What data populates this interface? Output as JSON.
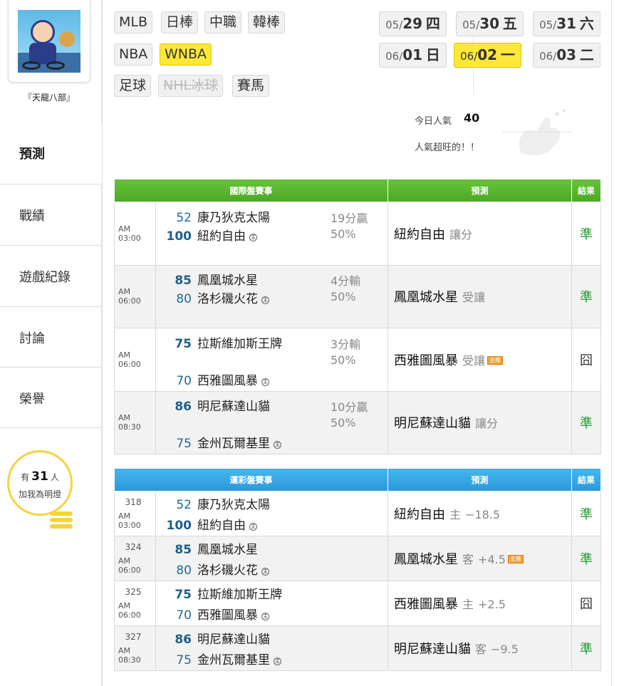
{
  "sidebar": {
    "username": "『天龍八部』",
    "nav": [
      "預測",
      "戰績",
      "遊戲紀錄",
      "討論",
      "榮譽"
    ],
    "fans_prefix": "有",
    "fans_count": "31",
    "fans_suffix": "人",
    "fans_text": "加我為明燈"
  },
  "sports": {
    "row1": [
      "MLB",
      "日棒",
      "中職",
      "韓棒"
    ],
    "row2": [
      "NBA",
      "WNBA"
    ],
    "row3": [
      "足球",
      "NHL冰球",
      "賽馬"
    ],
    "selected": "WNBA",
    "disabled": "NHL冰球"
  },
  "dates": [
    {
      "month": "05/",
      "day": "29",
      "weekday": "四"
    },
    {
      "month": "05/",
      "day": "30",
      "weekday": "五"
    },
    {
      "month": "05/",
      "day": "31",
      "weekday": "六"
    },
    {
      "month": "06/",
      "day": "01",
      "weekday": "日"
    },
    {
      "month": "06/",
      "day": "02",
      "weekday": "一"
    },
    {
      "month": "06/",
      "day": "03",
      "weekday": "二"
    }
  ],
  "selected_date": "06/02",
  "popularity": {
    "label": "今日人氣",
    "value": "40",
    "text": "人氣超旺的！！"
  },
  "intl_table": {
    "headers": [
      "國際盤賽事",
      "預測",
      "結果"
    ],
    "rows": [
      {
        "time": "AM 03:00",
        "away_score": "52",
        "away_team": "康乃狄克太陽",
        "home_score": "100",
        "home_team": "紐約自由",
        "home_mark": "主",
        "line": "19分贏",
        "pct": "50%",
        "pred_team": "紐約自由",
        "pred_sub": "讓分",
        "badge": "",
        "result": "準"
      },
      {
        "time": "AM 06:00",
        "away_score": "85",
        "away_team": "鳳凰城水星",
        "home_score": "80",
        "home_team": "洛杉磯火花",
        "home_mark": "主",
        "line": "4分輸",
        "pct": "50%",
        "pred_team": "鳳凰城水星",
        "pred_sub": "受讓",
        "badge": "",
        "result": "準"
      },
      {
        "time": "AM 06:00",
        "away_score": "75",
        "away_team": "拉斯維加斯王牌",
        "home_score": "70",
        "home_team": "西雅圖風暴",
        "home_mark": "主",
        "line": "3分輸",
        "pct": "50%",
        "pred_team": "西雅圖風暴",
        "pred_sub": "受讓",
        "badge": "主推",
        "result": "囧"
      },
      {
        "time": "AM 08:30",
        "away_score": "86",
        "away_team": "明尼蘇達山貓",
        "home_score": "75",
        "home_team": "金州瓦爾基里",
        "home_mark": "主",
        "line": "10分贏",
        "pct": "50%",
        "pred_team": "明尼蘇達山貓",
        "pred_sub": "讓分",
        "badge": "",
        "result": "準"
      }
    ]
  },
  "lottery_table": {
    "headers": [
      "運彩盤賽事",
      "預測",
      "結果"
    ],
    "rows": [
      {
        "no": "318",
        "time": "AM 03:00",
        "away_score": "52",
        "away_team": "康乃狄克太陽",
        "home_score": "100",
        "home_team": "紐約自由",
        "home_mark": "主",
        "pred_team": "紐約自由",
        "pred_side": "主",
        "pred_line": "−18.5",
        "badge": "",
        "result": "準"
      },
      {
        "no": "324",
        "time": "AM 06:00",
        "away_score": "85",
        "away_team": "鳳凰城水星",
        "home_score": "80",
        "home_team": "洛杉磯火花",
        "home_mark": "主",
        "pred_team": "鳳凰城水星",
        "pred_side": "客",
        "pred_line": "+4.5",
        "badge": "主推",
        "result": "準"
      },
      {
        "no": "325",
        "time": "AM 06:00",
        "away_score": "75",
        "away_team": "拉斯維加斯王牌",
        "home_score": "70",
        "home_team": "西雅圖風暴",
        "home_mark": "主",
        "pred_team": "西雅圖風暴",
        "pred_side": "主",
        "pred_line": "+2.5",
        "badge": "",
        "result": "囧"
      },
      {
        "no": "327",
        "time": "AM 08:30",
        "away_score": "86",
        "away_team": "明尼蘇達山貓",
        "home_score": "75",
        "home_team": "金州瓦爾基里",
        "home_mark": "主",
        "pred_team": "明尼蘇達山貓",
        "pred_side": "客",
        "pred_line": "−9.5",
        "badge": "",
        "result": "準"
      }
    ]
  }
}
